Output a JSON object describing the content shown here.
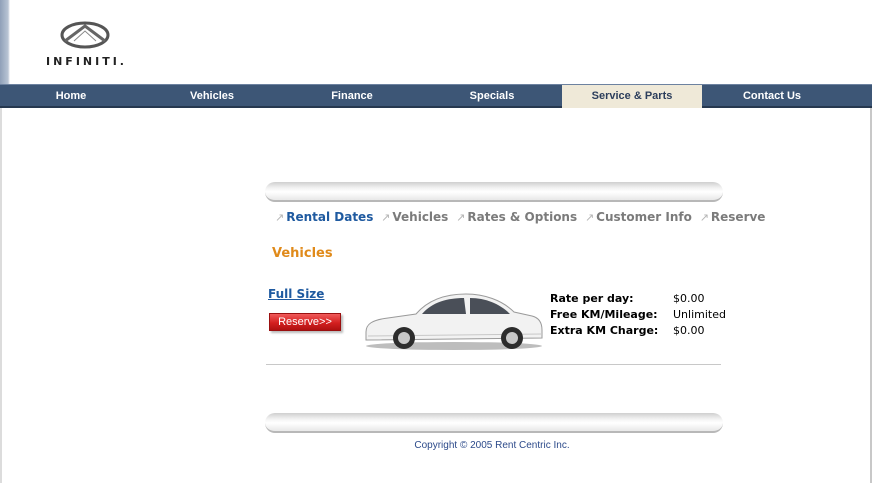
{
  "brand": {
    "logo_text": "INFINITI.",
    "logo_icon": "infiniti-emblem"
  },
  "nav": {
    "items": [
      {
        "label": "Home",
        "active": false
      },
      {
        "label": "Vehicles",
        "active": false
      },
      {
        "label": "Finance",
        "active": false
      },
      {
        "label": "Specials",
        "active": false
      },
      {
        "label": "Service & Parts",
        "active": true
      },
      {
        "label": "Contact Us",
        "active": false
      }
    ]
  },
  "steps": [
    {
      "label": "Rental Dates",
      "active": true
    },
    {
      "label": "Vehicles",
      "active": false
    },
    {
      "label": "Rates & Options",
      "active": false
    },
    {
      "label": "Customer Info",
      "active": false
    },
    {
      "label": "Reserve",
      "active": false
    }
  ],
  "step_arrow_icon": "arrow-up-right-icon",
  "section_title": "Vehicles",
  "vehicle": {
    "class_name": "Full Size",
    "reserve_label": "Reserve>>",
    "image_icon": "sedan-car-image",
    "rates": [
      {
        "label": "Rate per day:",
        "value": "$0.00"
      },
      {
        "label": "Free KM/Mileage:",
        "value": "Unlimited"
      },
      {
        "label": "Extra KM Charge:",
        "value": "$0.00"
      }
    ]
  },
  "copyright": "Copyright © 2005 Rent Centric Inc.",
  "colors": {
    "nav_bg": "#3d5676",
    "nav_active_bg": "#efe9d8",
    "step_active": "#1f5aa0",
    "title": "#e08a1a",
    "reserve": "#d42020"
  }
}
